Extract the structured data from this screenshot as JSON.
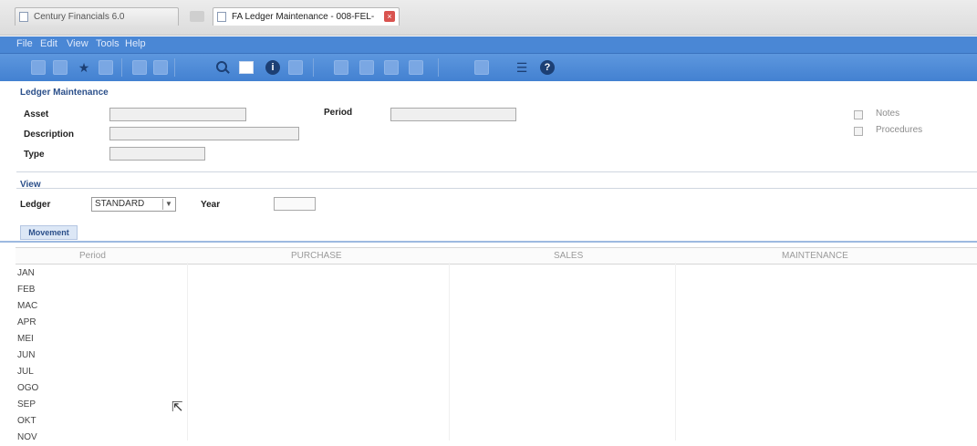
{
  "tabs": [
    {
      "label": "Century Financials 6.0"
    },
    {
      "label": "FA Ledger Maintenance - 008-FEL-"
    }
  ],
  "menu": [
    "File",
    "Edit",
    "View",
    "Tools",
    "Help"
  ],
  "toolbar_icons": [
    "save-icon",
    "undo-icon",
    "star-icon",
    "delete-icon",
    "print-icon",
    "copy-icon",
    "search-icon",
    "blank-icon",
    "info-icon",
    "clear-icon",
    "first-icon",
    "prev-icon",
    "next-icon",
    "last-icon",
    "attach-icon",
    "filter-icon",
    "help-icon"
  ],
  "ledger_maintenance": {
    "title": "Ledger Maintenance",
    "asset_label": "Asset",
    "period_label": "Period",
    "description_label": "Description",
    "type_label": "Type",
    "asset_value": "",
    "period_value": "",
    "description_value": "",
    "type_value": "",
    "notes_label": "Notes",
    "procedures_label": "Procedures"
  },
  "view": {
    "title": "View",
    "ledger_label": "Ledger",
    "ledger_value": "STANDARD",
    "year_label": "Year",
    "year_value": ""
  },
  "subtab": "Movement",
  "grid": {
    "columns": [
      "Period",
      "PURCHASE",
      "SALES",
      "MAINTENANCE"
    ],
    "rows": [
      "JAN",
      "FEB",
      "MAC",
      "APR",
      "MEI",
      "JUN",
      "JUL",
      "OGO",
      "SEP",
      "OKT",
      "NOV"
    ]
  }
}
